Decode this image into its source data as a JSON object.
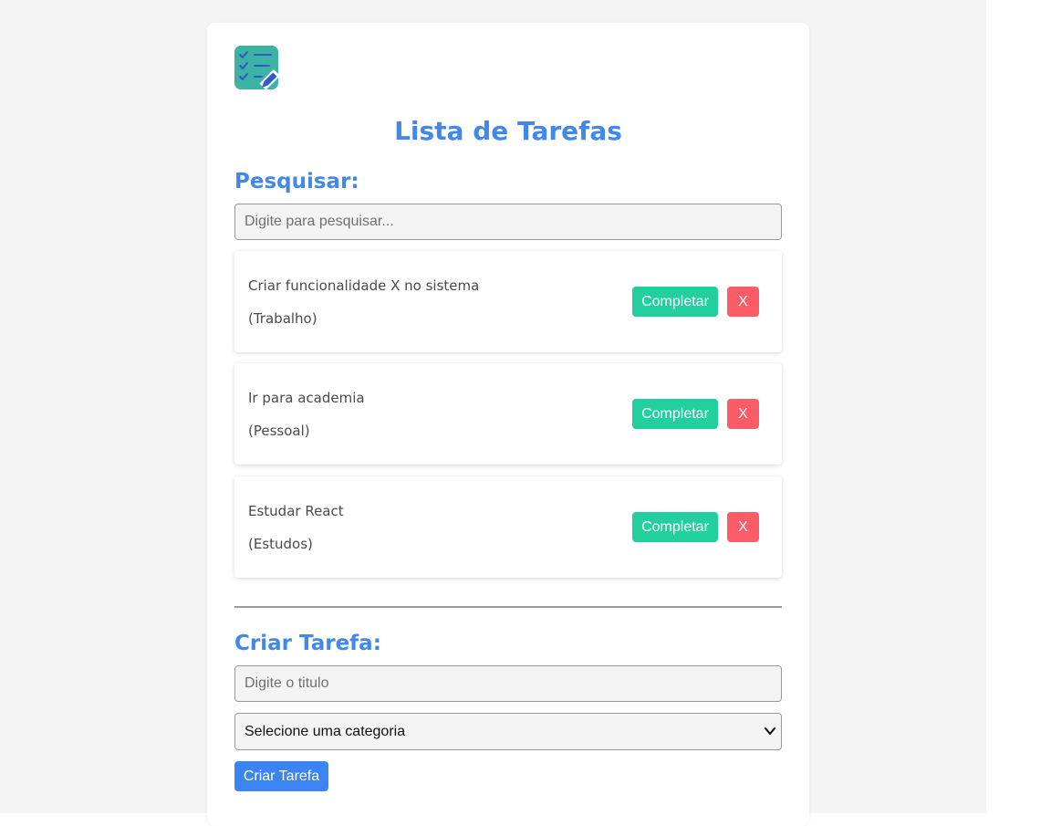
{
  "app": {
    "title": "Lista de Tarefas",
    "logo_icon": "checklist-pencil-icon"
  },
  "colors": {
    "accent": "#4388e8",
    "complete_button": "#21d09d",
    "remove_button": "#fb5c67",
    "create_button": "#3b84f3",
    "logo_teal": "#3cb3a3",
    "logo_check": "#2f58c9"
  },
  "search": {
    "heading": "Pesquisar:",
    "placeholder": "Digite para pesquisar...",
    "value": ""
  },
  "tasks": [
    {
      "title": "Criar funcionalidade X no sistema",
      "category": "(Trabalho)",
      "complete_label": "Completar",
      "remove_label": "X"
    },
    {
      "title": "Ir para academia",
      "category": "(Pessoal)",
      "complete_label": "Completar",
      "remove_label": "X"
    },
    {
      "title": "Estudar React",
      "category": "(Estudos)",
      "complete_label": "Completar",
      "remove_label": "X"
    }
  ],
  "create": {
    "heading": "Criar Tarefa:",
    "title_placeholder": "Digite o titulo",
    "title_value": "",
    "category_selected": "Selecione uma categoria",
    "button_label": "Criar Tarefa"
  }
}
